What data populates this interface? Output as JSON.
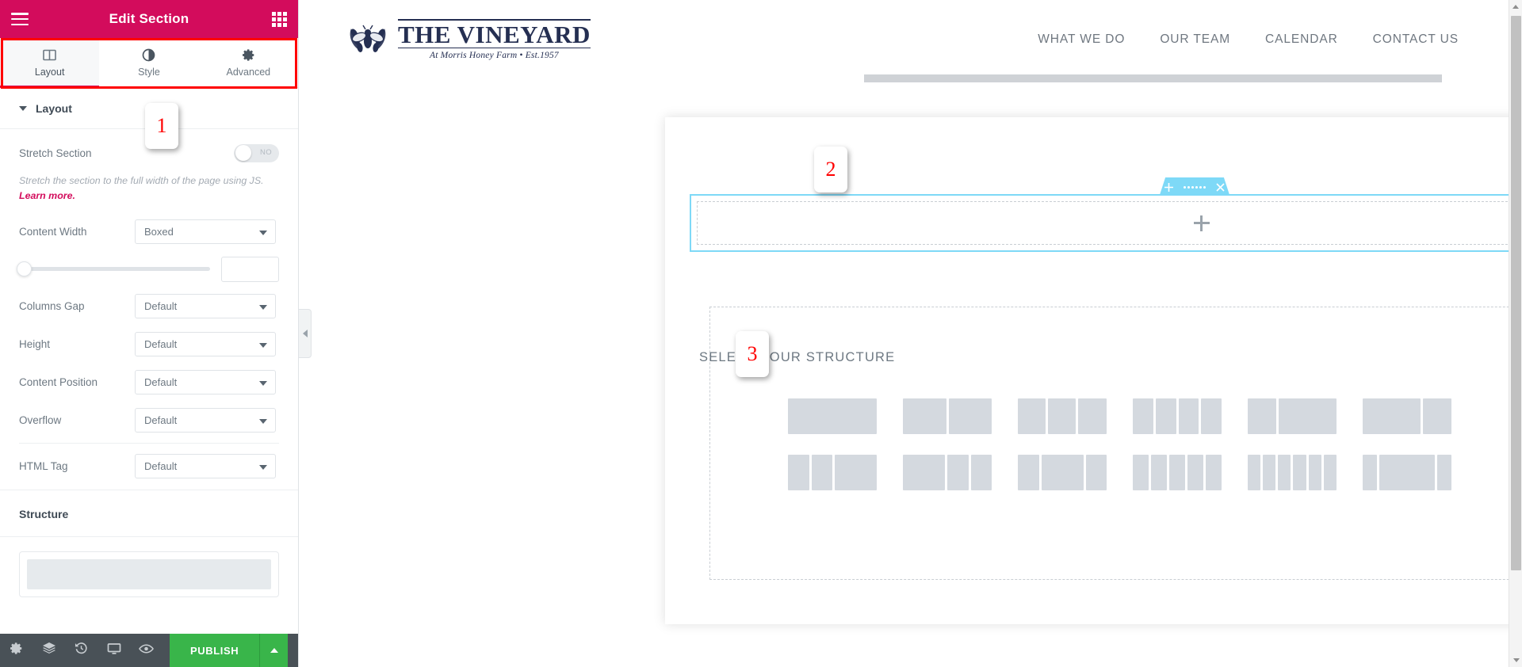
{
  "panel": {
    "title": "Edit Section",
    "menu_icon": "hamburger-icon",
    "apps_icon": "grid-icon",
    "tabs": [
      {
        "label": "Layout",
        "icon": "columns-icon",
        "active": true
      },
      {
        "label": "Style",
        "icon": "contrast-icon",
        "active": false
      },
      {
        "label": "Advanced",
        "icon": "gear-icon",
        "active": false
      }
    ],
    "layout_section": {
      "title": "Layout",
      "stretch": {
        "label": "Stretch Section",
        "toggle_value": "NO",
        "description_prefix": "Stretch the section to the full width of the page using JS. ",
        "description_link": "Learn more."
      },
      "fields": [
        {
          "label": "Content Width",
          "value": "Boxed"
        },
        {
          "label": "Columns Gap",
          "value": "Default"
        },
        {
          "label": "Height",
          "value": "Default"
        },
        {
          "label": "Content Position",
          "value": "Default"
        },
        {
          "label": "Overflow",
          "value": "Default"
        },
        {
          "label": "HTML Tag",
          "value": "Default"
        }
      ],
      "slider": {
        "value": "",
        "placeholder": ""
      }
    },
    "structure_section": {
      "title": "Structure"
    },
    "toolbar": {
      "items": [
        {
          "icon": "gear-icon",
          "name": "settings-button"
        },
        {
          "icon": "layers-icon",
          "name": "navigator-button"
        },
        {
          "icon": "history-icon",
          "name": "history-button"
        },
        {
          "icon": "monitor-icon",
          "name": "responsive-button"
        },
        {
          "icon": "eye-icon",
          "name": "preview-button"
        }
      ],
      "publish_label": "PUBLISH",
      "publish_color": "#39b54a"
    },
    "collapse_icon": "chevron-left-icon",
    "accent_color": "#d30c5c",
    "highlight_color": "#ff0000"
  },
  "site": {
    "logo": {
      "title": "THE VINEYARD",
      "tagline": "At Morris Honey Farm • Est.1957",
      "mark": "bee-laurel-icon"
    },
    "nav": [
      {
        "label": "WHAT WE DO"
      },
      {
        "label": "OUR TEAM"
      },
      {
        "label": "CALENDAR"
      },
      {
        "label": "CONTACT US"
      }
    ]
  },
  "editor": {
    "section_toolbar": [
      {
        "icon": "plus-icon",
        "name": "add-section-button"
      },
      {
        "icon": "dots-grid-icon",
        "name": "edit-section-handle"
      },
      {
        "icon": "close-icon",
        "name": "delete-section-button"
      }
    ],
    "new_section": {
      "add_icon": "plus-icon"
    },
    "structure_chooser": {
      "title": "SELECT YOUR STRUCTURE",
      "close_icon": "close-icon",
      "presets": [
        [
          [
            100
          ],
          [
            50,
            50
          ],
          [
            33,
            33,
            34
          ],
          [
            25,
            25,
            25,
            25
          ],
          [
            33,
            67
          ],
          [
            67,
            33
          ]
        ],
        [
          [
            25,
            25,
            50
          ],
          [
            50,
            25,
            25
          ],
          [
            25,
            50,
            25
          ],
          [
            20,
            20,
            20,
            20,
            20
          ],
          [
            16,
            17,
            17,
            17,
            17,
            16
          ],
          [
            17,
            66,
            17
          ]
        ]
      ]
    },
    "selection_color": "#7ed9f7"
  },
  "callouts": [
    {
      "number": "1"
    },
    {
      "number": "2"
    },
    {
      "number": "3"
    }
  ],
  "scrollbar": {
    "up_icon": "caret-up-icon",
    "down_icon": "caret-down-icon"
  }
}
